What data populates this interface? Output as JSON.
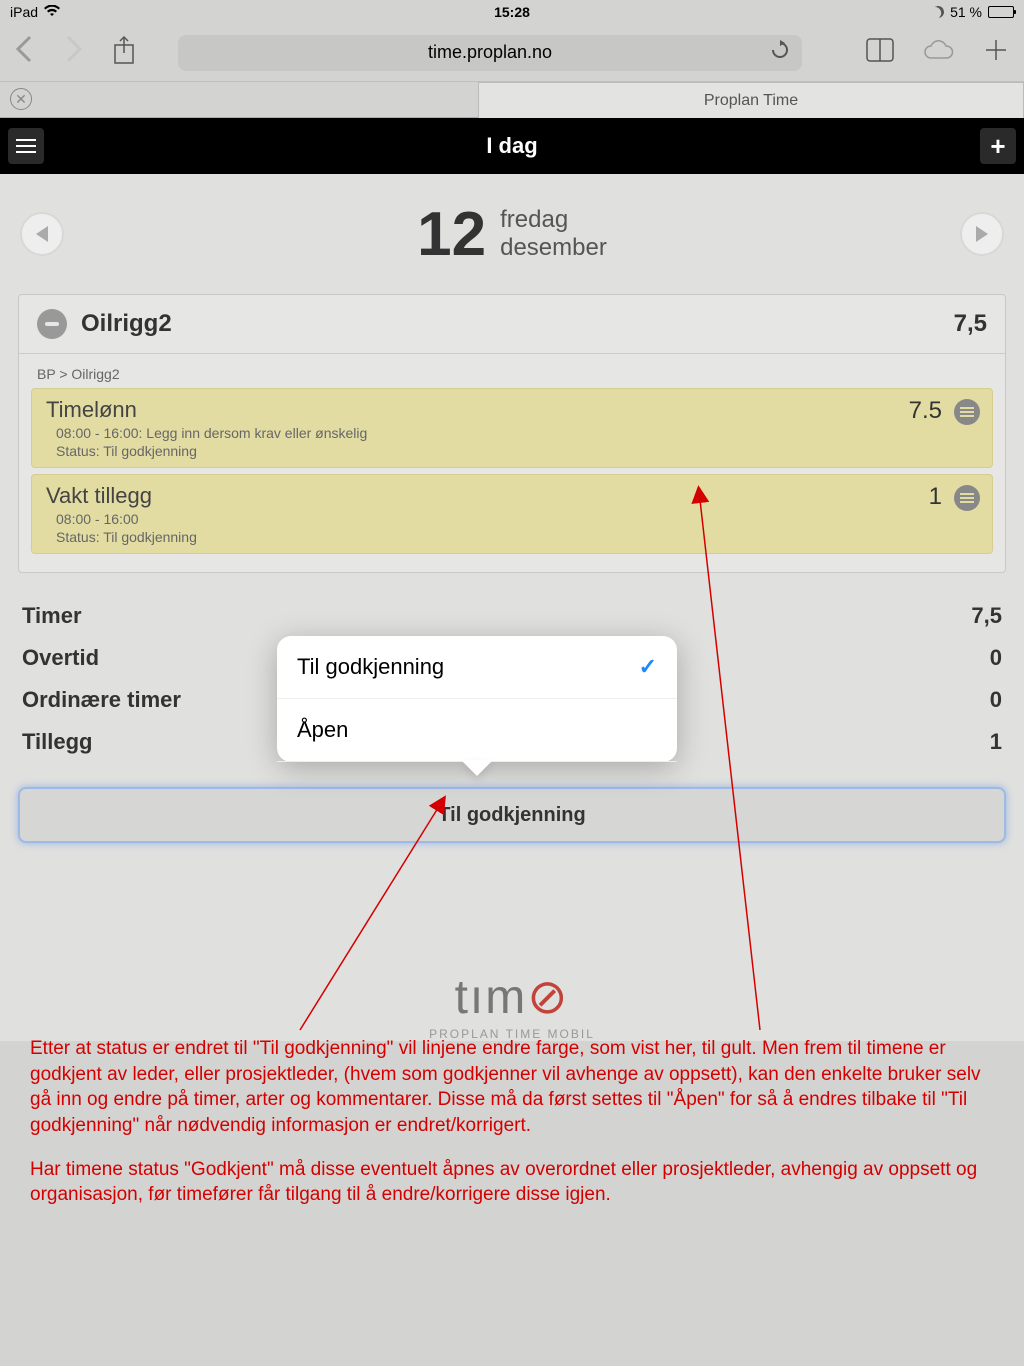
{
  "statusbar": {
    "device": "iPad",
    "time": "15:28",
    "battery_pct": "51 %"
  },
  "safari": {
    "url": "time.proplan.no",
    "tab_title": "Proplan Time"
  },
  "app": {
    "header_title": "I dag",
    "date_number": "12",
    "weekday": "fredag",
    "month": "desember"
  },
  "project": {
    "name": "Oilrigg2",
    "total": "7,5",
    "breadcrumb": "BP > Oilrigg2",
    "entries": [
      {
        "title": "Timelønn",
        "hours": "7.5",
        "time": "08:00 - 16:00: Legg inn dersom krav eller ønskelig",
        "status": "Status: Til godkjenning"
      },
      {
        "title": "Vakt tillegg",
        "hours": "1",
        "time": "08:00 - 16:00",
        "status": "Status: Til godkjenning"
      }
    ]
  },
  "summary": {
    "rows": [
      {
        "label": "Timer",
        "value": "7,5"
      },
      {
        "label": "Overtid",
        "value": "0"
      },
      {
        "label": "Ordinære timer",
        "value": "0"
      },
      {
        "label": "Tillegg",
        "value": "1"
      }
    ]
  },
  "popover": {
    "options": [
      {
        "label": "Til godkjenning",
        "selected": true
      },
      {
        "label": "Åpen",
        "selected": false
      }
    ]
  },
  "action_button": "Til godkjenning",
  "logo": {
    "sub": "PROPLAN TIME MOBIL"
  },
  "annotation": {
    "p1": "Etter at status er endret til \"Til godkjenning\" vil linjene endre farge, som vist her, til gult. Men frem til timene er godkjent av leder, eller prosjektleder, (hvem som godkjenner vil avhenge av oppsett), kan den enkelte bruker selv gå inn og endre på timer, arter og kommentarer. Disse må da først settes til \"Åpen\" for så å endres tilbake til \"Til godkjenning\" når nødvendig informasjon er endret/korrigert.",
    "p2": "Har timene status \"Godkjent\" må disse eventuelt åpnes av overordnet eller prosjektleder, avhengig av oppsett og organisasjon, før timefører får tilgang til å endre/korrigere disse igjen."
  }
}
